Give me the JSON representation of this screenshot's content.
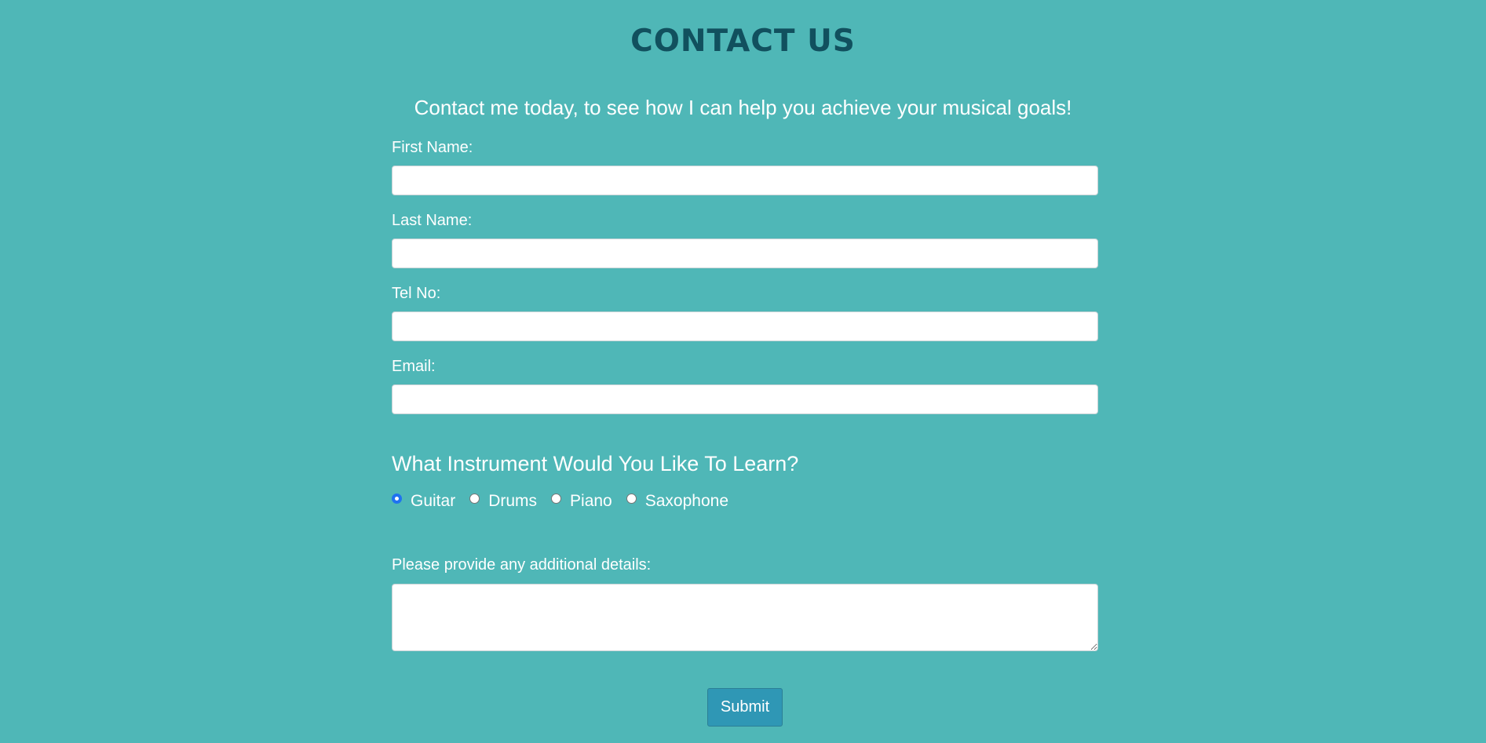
{
  "page": {
    "title": "CONTACT US",
    "subtitle": "Contact me today, to see how I can help you achieve your musical goals!"
  },
  "form": {
    "first_name": {
      "label": "First Name:",
      "value": ""
    },
    "last_name": {
      "label": "Last Name:",
      "value": ""
    },
    "tel_no": {
      "label": "Tel No:",
      "value": ""
    },
    "email": {
      "label": "Email:",
      "value": ""
    },
    "instrument": {
      "heading": "What Instrument Would You Like To Learn?",
      "options": [
        "Guitar",
        "Drums",
        "Piano",
        "Saxophone"
      ],
      "selected": "Guitar"
    },
    "details": {
      "label": "Please provide any additional details:",
      "value": ""
    },
    "submit_label": "Submit"
  },
  "colors": {
    "background": "#4fb7b7",
    "title": "#11505e",
    "button": "#2f97b5",
    "radio_checked": "#1f72f0"
  }
}
